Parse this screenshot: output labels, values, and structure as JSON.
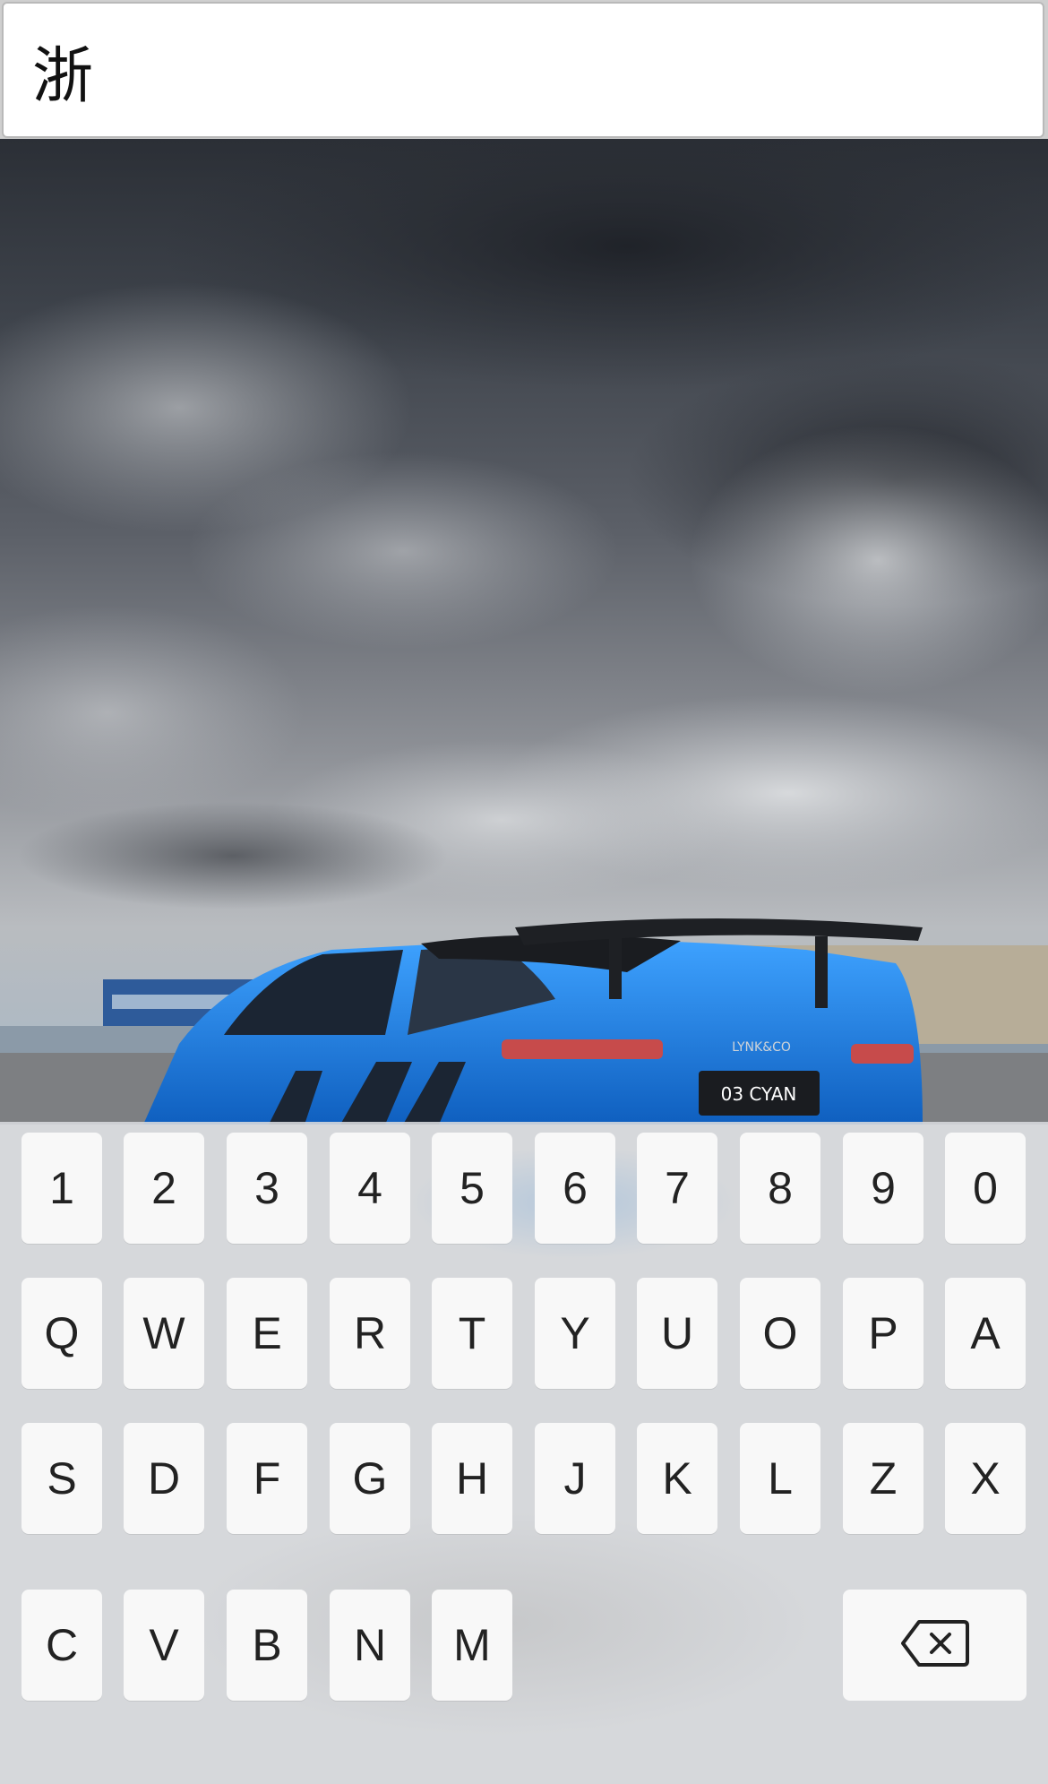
{
  "input": {
    "value": "浙"
  },
  "keyboard": {
    "rows": [
      [
        "1",
        "2",
        "3",
        "4",
        "5",
        "6",
        "7",
        "8",
        "9",
        "0"
      ],
      [
        "Q",
        "W",
        "E",
        "R",
        "T",
        "Y",
        "U",
        "O",
        "P",
        "A"
      ],
      [
        "S",
        "D",
        "F",
        "G",
        "H",
        "J",
        "K",
        "L",
        "Z",
        "X"
      ],
      [
        "C",
        "V",
        "B",
        "N",
        "M"
      ]
    ],
    "delete_icon": "backspace-icon"
  },
  "photo": {
    "car_badge": "03 CYAN",
    "car_logo": "LYNK&CO",
    "sky_color": "#3a3f47",
    "car_color": "#1f7fe0"
  }
}
